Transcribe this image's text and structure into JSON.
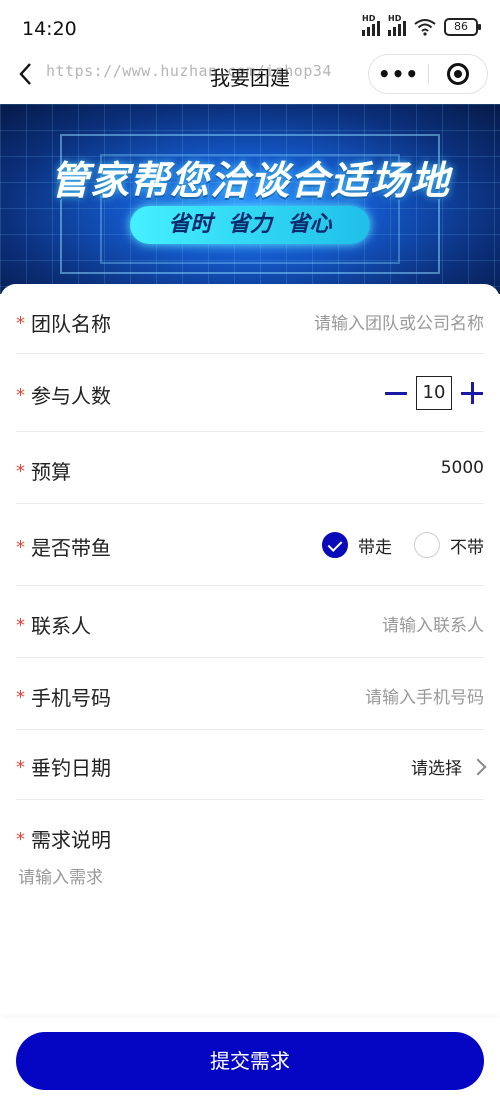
{
  "status_bar": {
    "time": "14:20",
    "network_1": "HD",
    "network_2": "HD",
    "battery": "86"
  },
  "navbar": {
    "title": "我要团建",
    "watermark": "https://www.huzhan.com/ishop34",
    "more_label": "•••"
  },
  "banner": {
    "headline": "管家帮您洽谈合适场地",
    "tagline": "省时 省力 省心"
  },
  "form": {
    "team_name": {
      "label": "团队名称",
      "placeholder": "请输入团队或公司名称"
    },
    "participants": {
      "label": "参与人数",
      "value": "10"
    },
    "budget": {
      "label": "预算",
      "value": "5000"
    },
    "take_fish": {
      "label": "是否带鱼",
      "options": [
        "带走",
        "不带"
      ],
      "selected": "带走"
    },
    "contact": {
      "label": "联系人",
      "placeholder": "请输入联系人"
    },
    "phone": {
      "label": "手机号码",
      "placeholder": "请输入手机号码"
    },
    "fishing_date": {
      "label": "垂钓日期",
      "value": "请选择"
    },
    "requirements": {
      "label": "需求说明",
      "placeholder": "请输入需求"
    }
  },
  "submit_label": "提交需求",
  "required_mark": "*",
  "colors": {
    "primary": "#0505c4",
    "required": "#e2453c"
  }
}
